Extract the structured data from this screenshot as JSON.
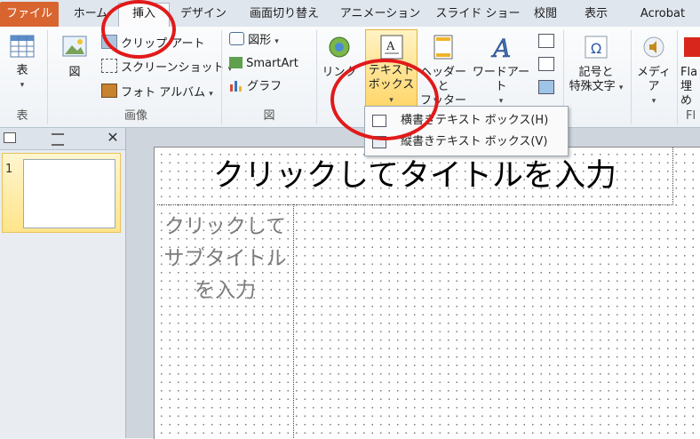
{
  "tabs": [
    {
      "label": "ファイル"
    },
    {
      "label": "ホーム"
    },
    {
      "label": "挿入"
    },
    {
      "label": "デザイン"
    },
    {
      "label": "画面切り替え"
    },
    {
      "label": "アニメーション"
    },
    {
      "label": "スライド ショー"
    },
    {
      "label": "校閲"
    },
    {
      "label": "表示"
    },
    {
      "label": "Acrobat"
    }
  ],
  "ribbon": {
    "table": {
      "label": "表",
      "group": "表"
    },
    "images": {
      "picture": "図",
      "clipart": "クリップ アート",
      "screenshot": "スクリーンショット",
      "photoalbum": "フォト アルバム",
      "group": "画像"
    },
    "illustrations": {
      "shapes": "図形",
      "smartart": "SmartArt",
      "chart": "グラフ",
      "group": "図"
    },
    "link": {
      "label": "リンク"
    },
    "text": {
      "textbox_line1": "テキスト",
      "textbox_line2": "ボックス",
      "headerfooter_line1": "ヘッダーと",
      "headerfooter_line2": "フッター",
      "wordart": "ワードアート"
    },
    "symbols": {
      "line1": "記号と",
      "line2": "特殊文字"
    },
    "media": {
      "label": "メディア"
    },
    "flash": {
      "line1": "Fla",
      "line2": "埋め",
      "group": "Fl"
    }
  },
  "dropdown": {
    "horizontal": "横書きテキスト ボックス(H)",
    "vertical": "縦書きテキスト ボックス(V)"
  },
  "slides": {
    "number": "1",
    "close": "✕"
  },
  "slide": {
    "title": "クリックしてタイトルを入力",
    "subtitle": "クリックしてサブタイトルを入力"
  }
}
